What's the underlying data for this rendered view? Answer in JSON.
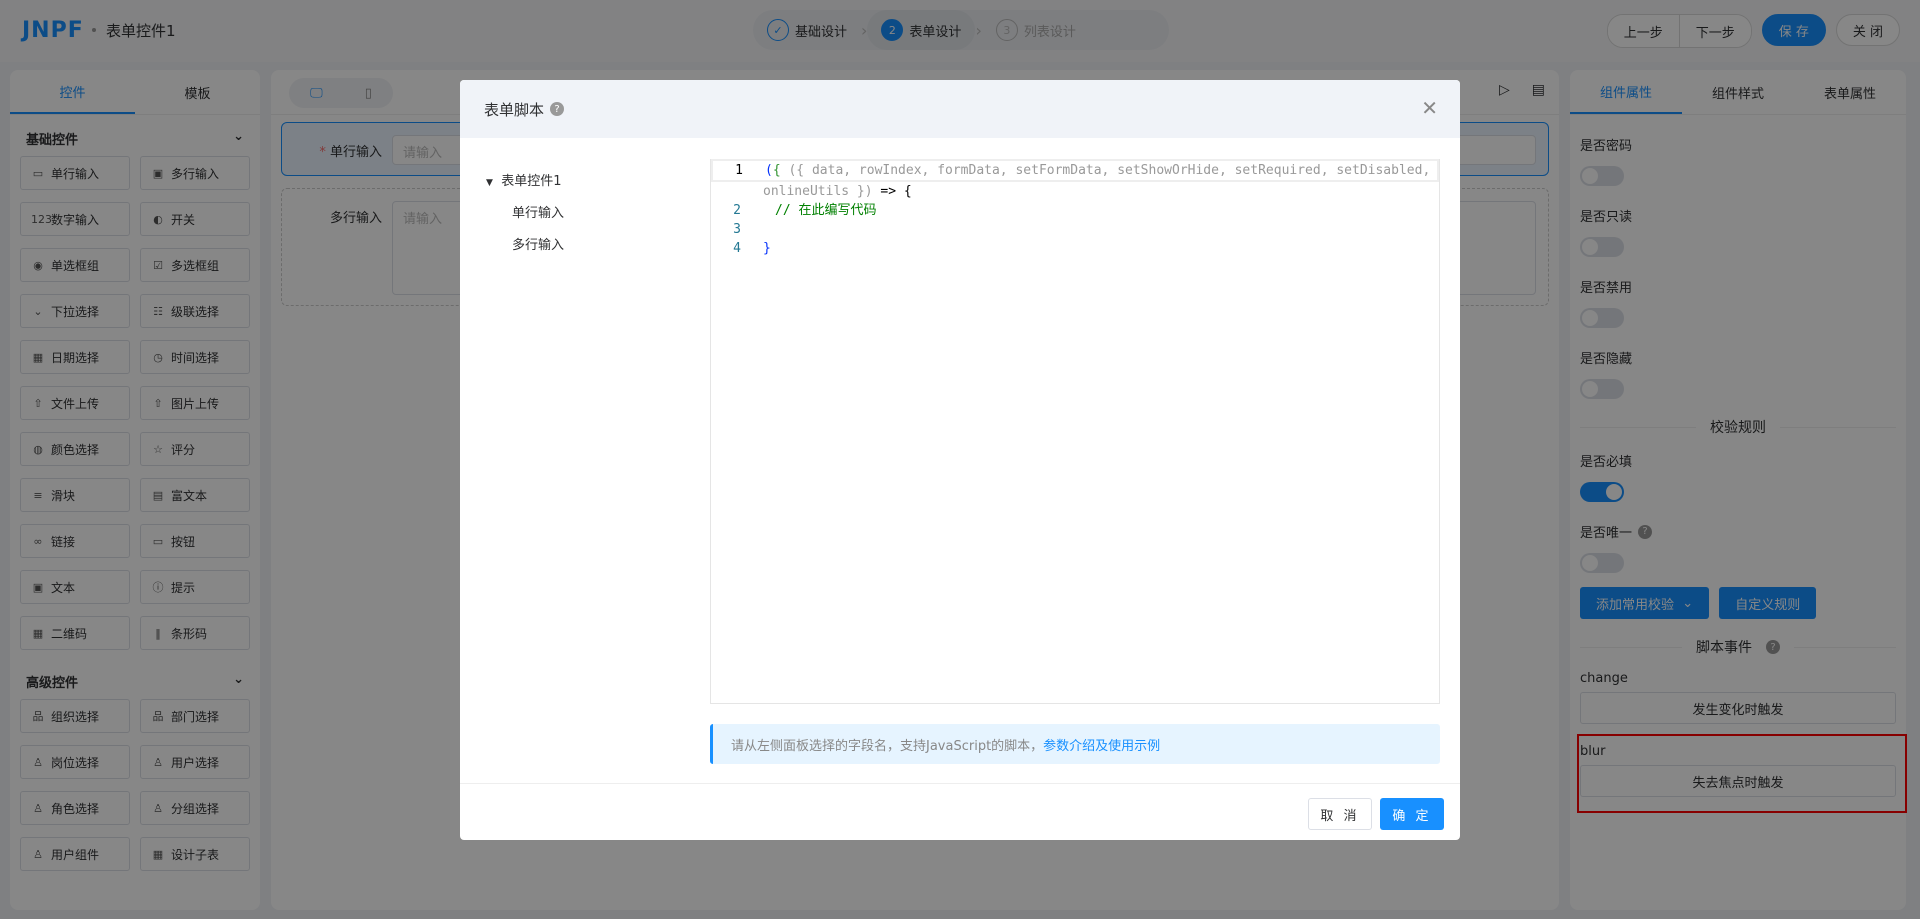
{
  "header": {
    "logo": "JNPF",
    "title": "表单控件1",
    "steps": [
      {
        "n": "✓",
        "label": "基础设计"
      },
      {
        "n": "2",
        "label": "表单设计"
      },
      {
        "n": "3",
        "label": "列表设计"
      }
    ],
    "prev": "上一步",
    "next": "下一步",
    "save": "保 存",
    "close": "关 闭"
  },
  "left": {
    "tabs": [
      "控件",
      "模板"
    ],
    "basic_title": "基础控件",
    "advanced_title": "高级控件",
    "basic": [
      {
        "icon": "▭",
        "label": "单行输入"
      },
      {
        "icon": "▣",
        "label": "多行输入"
      },
      {
        "icon": "123",
        "label": "数字输入"
      },
      {
        "icon": "◐",
        "label": "开关"
      },
      {
        "icon": "◉",
        "label": "单选框组"
      },
      {
        "icon": "☑",
        "label": "多选框组"
      },
      {
        "icon": "⌄",
        "label": "下拉选择"
      },
      {
        "icon": "☷",
        "label": "级联选择"
      },
      {
        "icon": "▦",
        "label": "日期选择"
      },
      {
        "icon": "◷",
        "label": "时间选择"
      },
      {
        "icon": "⇧",
        "label": "文件上传"
      },
      {
        "icon": "⇧",
        "label": "图片上传"
      },
      {
        "icon": "◍",
        "label": "颜色选择"
      },
      {
        "icon": "☆",
        "label": "评分"
      },
      {
        "icon": "≡",
        "label": "滑块"
      },
      {
        "icon": "▤",
        "label": "富文本"
      },
      {
        "icon": "∞",
        "label": "链接"
      },
      {
        "icon": "▭",
        "label": "按钮"
      },
      {
        "icon": "▣",
        "label": "文本"
      },
      {
        "icon": "ⓘ",
        "label": "提示"
      },
      {
        "icon": "▦",
        "label": "二维码"
      },
      {
        "icon": "‖",
        "label": "条形码"
      }
    ],
    "advanced": [
      {
        "icon": "品",
        "label": "组织选择"
      },
      {
        "icon": "品",
        "label": "部门选择"
      },
      {
        "icon": "♙",
        "label": "岗位选择"
      },
      {
        "icon": "♙",
        "label": "用户选择"
      },
      {
        "icon": "♙",
        "label": "角色选择"
      },
      {
        "icon": "♙",
        "label": "分组选择"
      },
      {
        "icon": "♙",
        "label": "用户组件"
      },
      {
        "icon": "▦",
        "label": "设计子表"
      }
    ]
  },
  "canvas": {
    "fields": [
      {
        "label": "单行输入",
        "placeholder": "请输入"
      },
      {
        "label": "多行输入",
        "placeholder": "请输入"
      }
    ]
  },
  "right": {
    "tabs": [
      "组件属性",
      "组件样式",
      "表单属性"
    ],
    "toggles": [
      {
        "label": "是否密码",
        "on": false
      },
      {
        "label": "是否只读",
        "on": false
      },
      {
        "label": "是否禁用",
        "on": false
      },
      {
        "label": "是否隐藏",
        "on": false
      }
    ],
    "rules_title": "校验规则",
    "required": {
      "label": "是否必填",
      "on": true
    },
    "unique": {
      "label": "是否唯一",
      "on": false
    },
    "add_rule": "添加常用校验",
    "custom_rule": "自定义规则",
    "events_title": "脚本事件",
    "events": [
      {
        "name": "change",
        "button": "发生变化时触发"
      },
      {
        "name": "blur",
        "button": "失去焦点时触发"
      }
    ]
  },
  "modal": {
    "title": "表单脚本",
    "tree_root": "表单控件1",
    "tree_children": [
      "单行输入",
      "多行输入"
    ],
    "code": {
      "l1a": "({ data, rowIndex, formData, setFormData, setShowOrHide, setRequired, setDisabled,",
      "l1b": "onlineUtils })",
      "arrow": " => {",
      "l2": "// 在此编写代码",
      "l4": "}"
    },
    "info": "请从左侧面板选择的字段名，支持JavaScript的脚本，",
    "info_link": "参数介绍及使用示例",
    "cancel": "取 消",
    "ok": "确 定"
  }
}
